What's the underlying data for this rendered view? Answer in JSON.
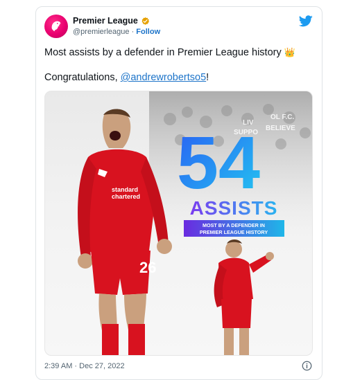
{
  "tweet": {
    "author": {
      "name": "Premier League",
      "handle": "@premierleague",
      "separator": "·",
      "follow_label": "Follow"
    },
    "text_line1": "Most assists by a defender in Premier League history",
    "text_line1_emoji": "👑",
    "text_line2_prefix": "Congratulations, ",
    "mention": "@andrewrobertso5",
    "text_line2_suffix": "!",
    "timestamp": "2:39 AM · Dec 27, 2022"
  },
  "graphic": {
    "big_number": "54",
    "headline": "ASSISTS",
    "subline_1": "MOST BY A DEFENDER IN",
    "subline_2": "PREMIER LEAGUE HISTORY",
    "shirt_number": "26",
    "sponsor_1": "standard",
    "sponsor_2": "chartered",
    "banner_1": "LIV",
    "banner_2": "SUPPO",
    "banner_3": "OL F.C.",
    "banner_4": "BELIEVE"
  },
  "colors": {
    "accent": "#1d74c9",
    "pl_magenta": "#e9006f",
    "kit_red": "#d8121f",
    "number_blue": "#2a6df4",
    "number_cyan": "#22c7f0",
    "headline_purple": "#7a3cf0"
  },
  "icons": [
    "premier-league-lion-icon",
    "verified-badge-icon",
    "twitter-bird-icon",
    "info-icon"
  ]
}
